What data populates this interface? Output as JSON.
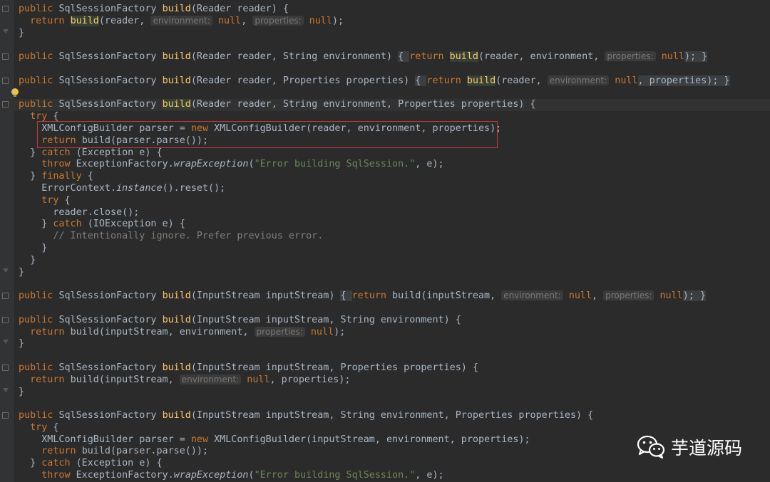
{
  "watermark": {
    "text": "芋道源码",
    "icon": "wechat-icon"
  },
  "code": {
    "l1": {
      "a": "public ",
      "b": "SqlSessionFactory ",
      "c": "build",
      "d": "(Reader reader) {"
    },
    "l2": {
      "a": "return ",
      "b": "build",
      "c": "(reader, ",
      "h1": "environment:",
      "d": " null",
      "e": ", ",
      "h2": "properties:",
      "f": " null",
      "g": ");"
    },
    "l3": {
      "a": "}"
    },
    "l5": {
      "a": "public ",
      "b": "SqlSessionFactory ",
      "c": "build",
      "d": "(Reader reader, String environment) ",
      "e": "{ ",
      "f": "return ",
      "g": "build",
      "h": "(reader, environment, ",
      "h1": "properties:",
      "i": " null",
      "j": "); ",
      "k": "}"
    },
    "l7": {
      "a": "public ",
      "b": "SqlSessionFactory ",
      "c": "build",
      "d": "(Reader reader, Properties properties) ",
      "e": "{ ",
      "f": "return ",
      "g": "build",
      "h": "(reader, ",
      "h1": "environment:",
      "i": " null",
      "j": ", properties); ",
      "k": "}"
    },
    "l9": {
      "a": "public ",
      "b": "SqlSessionFactory ",
      "c": "build",
      "d": "(Reader reader, String environment, Properties properties) {"
    },
    "l10": {
      "a": "try",
      "b": " {"
    },
    "l11": {
      "a": "XMLConfigBuilder parser = ",
      "b": "new ",
      "c": "XMLConfigBuilder(reader, environment, properties);"
    },
    "l12": {
      "a": "return ",
      "b": "build(parser.parse());"
    },
    "l13": {
      "a": "} ",
      "b": "catch ",
      "c": "(Exception e) {"
    },
    "l14": {
      "a": "throw ",
      "b": "ExceptionFactory.",
      "c": "wrapException",
      "d": "(",
      "e": "\"Error building SqlSession.\"",
      "f": ", e);"
    },
    "l15": {
      "a": "} ",
      "b": "finally",
      "c": " {"
    },
    "l16": {
      "a": "ErrorContext.",
      "b": "instance",
      "c": "().reset();"
    },
    "l17": {
      "a": "try",
      "b": " {"
    },
    "l18": {
      "a": "reader.close();"
    },
    "l19": {
      "a": "} ",
      "b": "catch ",
      "c": "(IOException e) {"
    },
    "l20": {
      "a": "// Intentionally ignore. Prefer previous error."
    },
    "l21": {
      "a": "}"
    },
    "l22": {
      "a": "}"
    },
    "l23": {
      "a": "}"
    },
    "l25": {
      "a": "public ",
      "b": "SqlSessionFactory ",
      "c": "build",
      "d": "(InputStream inputStream) ",
      "e": "{ ",
      "f": "return ",
      "g": "build(inputStream, ",
      "h1": "environment:",
      "i": " null",
      "j": ", ",
      "h2": "properties:",
      "k": " null",
      "l": "); ",
      "m": "}"
    },
    "l27": {
      "a": "public ",
      "b": "SqlSessionFactory ",
      "c": "build",
      "d": "(InputStream inputStream, String environment) {"
    },
    "l28": {
      "a": "return ",
      "b": "build(inputStream, environment, ",
      "h1": "properties:",
      "c": " null",
      "d": ");"
    },
    "l29": {
      "a": "}"
    },
    "l31": {
      "a": "public ",
      "b": "SqlSessionFactory ",
      "c": "build",
      "d": "(InputStream inputStream, Properties properties) {"
    },
    "l32": {
      "a": "return ",
      "b": "build(inputStream, ",
      "h1": "environment:",
      "c": " null",
      "d": ", properties);"
    },
    "l33": {
      "a": "}"
    },
    "l35": {
      "a": "public ",
      "b": "SqlSessionFactory ",
      "c": "build",
      "d": "(InputStream inputStream, String environment, Properties properties) {"
    },
    "l36": {
      "a": "try",
      "b": " {"
    },
    "l37": {
      "a": "XMLConfigBuilder parser = ",
      "b": "new ",
      "c": "XMLConfigBuilder(inputStream, environment, properties);"
    },
    "l38": {
      "a": "return ",
      "b": "build(parser.parse());"
    },
    "l39": {
      "a": "} ",
      "b": "catch ",
      "c": "(Exception e) {"
    },
    "l40": {
      "a": "throw ",
      "b": "ExceptionFactory.",
      "c": "wrapException",
      "d": "(",
      "e": "\"Error building SqlSession.\"",
      "f": ", e);"
    }
  }
}
